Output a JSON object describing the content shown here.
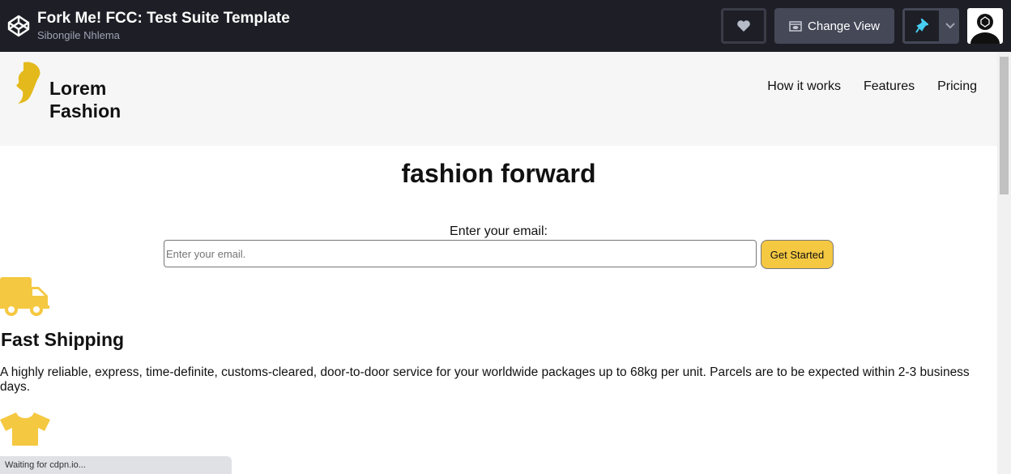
{
  "topbar": {
    "title": "Fork Me! FCC: Test Suite Template",
    "author": "Sibongile Nhlema",
    "change_view_label": "Change View"
  },
  "site": {
    "brand": "Lorem Fashion",
    "nav": [
      "How it works",
      "Features",
      "Pricing"
    ],
    "hero_title": "fashion forward",
    "email_label": "Enter your email:",
    "email_placeholder": "Enter your email.",
    "submit_label": "Get Started",
    "features": [
      {
        "icon": "truck-icon",
        "title": "Fast Shipping",
        "text": "A highly reliable, express, time-definite, customs-cleared, door-to-door service for your worldwide packages up to 68kg per unit. Parcels are to be expected within 2-3 business days."
      },
      {
        "icon": "tshirt-icon"
      }
    ],
    "accent": "#f5c842"
  },
  "status_text": "Waiting for cdpn.io..."
}
